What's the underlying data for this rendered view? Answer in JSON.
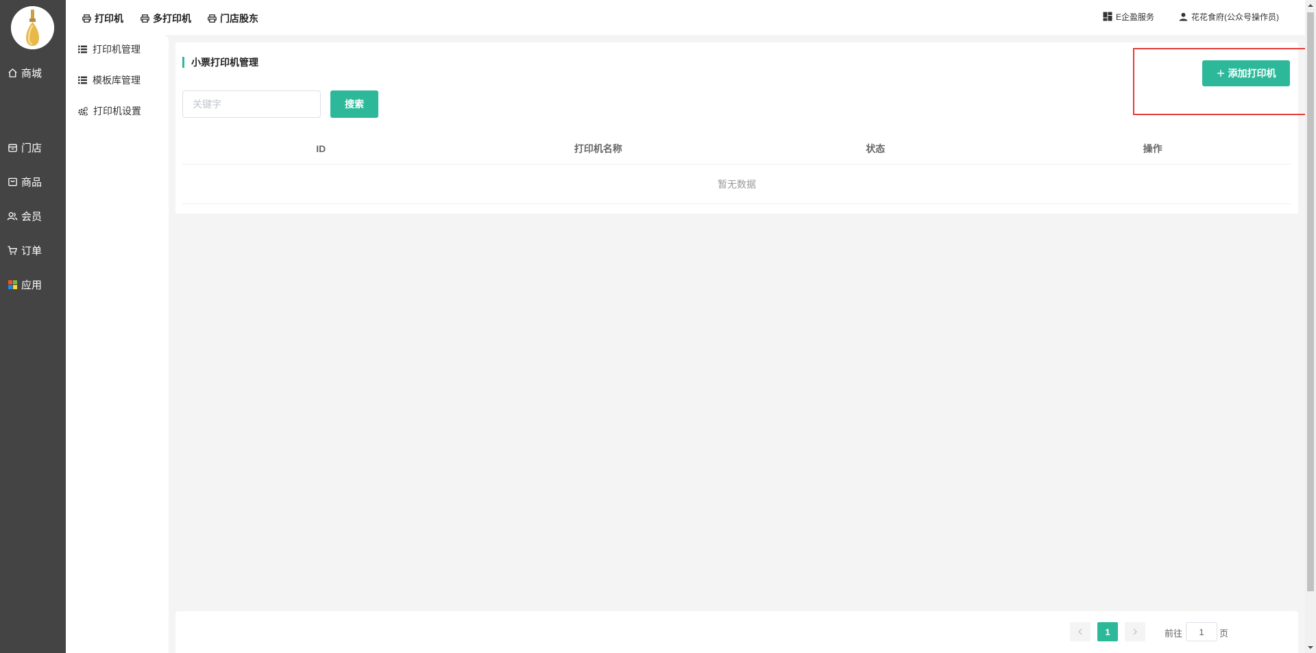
{
  "sidebar": {
    "items": [
      {
        "label": "商城",
        "icon": "home-icon"
      },
      {
        "label": "门店",
        "icon": "store-icon"
      },
      {
        "label": "商品",
        "icon": "product-icon"
      },
      {
        "label": "会员",
        "icon": "member-icon"
      },
      {
        "label": "订单",
        "icon": "cart-icon"
      },
      {
        "label": "应用",
        "icon": "apps-icon"
      }
    ]
  },
  "topbar": {
    "tabs": [
      {
        "label": "打印机",
        "icon": "printer-icon"
      },
      {
        "label": "多打印机",
        "icon": "printer-icon"
      },
      {
        "label": "门店股东",
        "icon": "printer-icon"
      }
    ],
    "enterprise_service": "E企盈服务",
    "user": "花花食府(公众号操作员)"
  },
  "subnav": {
    "items": [
      {
        "label": "打印机管理",
        "icon": "list-icon"
      },
      {
        "label": "模板库管理",
        "icon": "list-icon"
      },
      {
        "label": "打印机设置",
        "icon": "gears-icon"
      }
    ]
  },
  "main": {
    "title": "小票打印机管理",
    "add_button": "添加打印机",
    "search_placeholder": "关键字",
    "search_button": "搜索",
    "columns": [
      "ID",
      "打印机名称",
      "状态",
      "操作"
    ],
    "empty_text": "暂无数据"
  },
  "pagination": {
    "current_page": "1",
    "goto_prefix": "前往",
    "goto_value": "1",
    "goto_suffix": "页"
  },
  "colors": {
    "accent": "#2eb89a",
    "sidebar_bg": "#444444",
    "highlight": "#e53935"
  }
}
